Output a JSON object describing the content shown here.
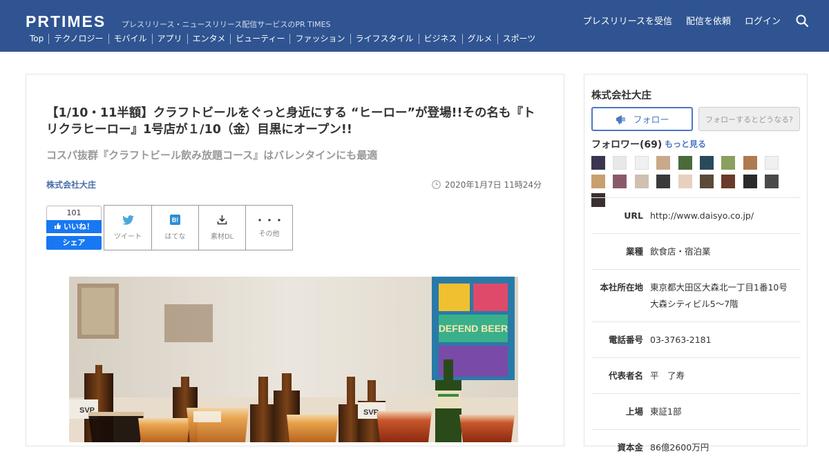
{
  "header": {
    "logo": "PRTIMES",
    "tagline": "プレスリリース・ニュースリリース配信サービスのPR TIMES",
    "categories": [
      "Top",
      "テクノロジー",
      "モバイル",
      "アプリ",
      "エンタメ",
      "ビューティー",
      "ファッション",
      "ライフスタイル",
      "ビジネス",
      "グルメ",
      "スポーツ"
    ],
    "nav": {
      "receive": "プレスリリースを受信",
      "request": "配信を依頼",
      "login": "ログイン",
      "search_icon": "search-icon"
    }
  },
  "article": {
    "title": "【1/10・11半額】クラフトビールをぐっと身近にする “ヒーロー”が登場!!その名も『トリクラヒーロー』1号店が１/10（金）目黒にオープン!!",
    "subtitle": "コスパ抜群『クラフトビール飲み放題コース』はバレンタインにも最適",
    "company": "株式会社大庄",
    "date": "2020年1月7日 11時24分",
    "facebook": {
      "count": "101",
      "like": "いいね！",
      "share": "シェア"
    },
    "share_buttons": [
      {
        "label": "ツイート",
        "icon": "twitter-icon"
      },
      {
        "label": "はてな",
        "icon": "hatena-icon"
      },
      {
        "label": "素材DL",
        "icon": "download-icon"
      },
      {
        "label": "その他",
        "icon": "more-icon"
      }
    ]
  },
  "sidebar": {
    "company_name": "株式会社大庄",
    "follow_label": "フォロー",
    "what_label": "フォローするとどうなる?",
    "followers_label": "フォロワー(69)",
    "more_label": "もっと見る",
    "avatar_colors": [
      "#3a3550",
      "#e8e8e8",
      "#f0f0f0",
      "#c9a98a",
      "#4a6a3a",
      "#2a4a5a",
      "#8aa060",
      "#b07a50",
      "#f0f0f0",
      "#c8a070",
      "#8a5a6a",
      "#d0c0b0",
      "#3a3a3a",
      "#e8d0c0",
      "#5a4a3a",
      "#6a3a2a",
      "#2a2a2a",
      "#4a4a4a",
      "#3a3030"
    ],
    "info": [
      {
        "key": "URL",
        "value": "http://www.daisyo.co.jp/"
      },
      {
        "key": "業種",
        "value": "飲食店・宿泊業"
      },
      {
        "key": "本社所在地",
        "value": "東京都大田区大森北一丁目1番10号\n大森シティビル5～7階"
      },
      {
        "key": "電話番号",
        "value": "03-3763-2181"
      },
      {
        "key": "代表者名",
        "value": "平　了寿"
      },
      {
        "key": "上場",
        "value": "東証1部"
      },
      {
        "key": "資本金",
        "value": "86億2600万円"
      }
    ]
  }
}
